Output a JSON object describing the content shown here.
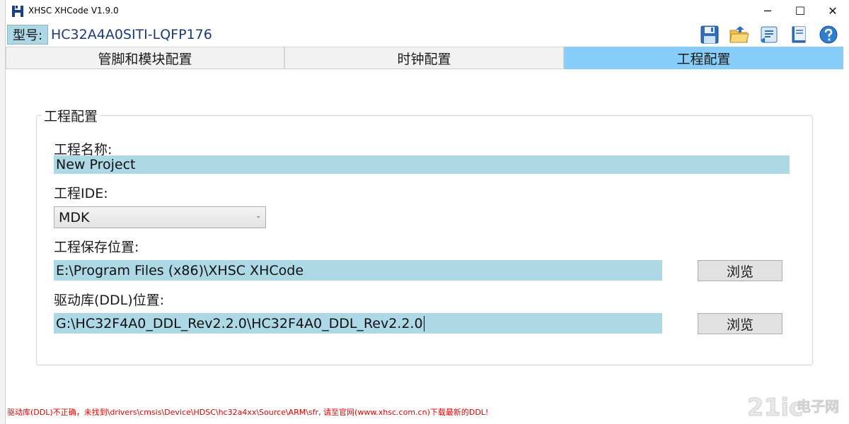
{
  "window": {
    "title": "XHSC XHCode V1.9.0",
    "controls": {
      "minimize": "─",
      "maximize": "☐",
      "close": "✕"
    }
  },
  "toolbar": {
    "model_label": "型号:",
    "model_value": "HC32A4A0SITI-LQFP176",
    "icons": [
      "save-icon",
      "open-folder-icon",
      "generate-code-icon",
      "book-icon",
      "help-icon"
    ]
  },
  "tabs": [
    {
      "label": "管脚和模块配置",
      "active": false
    },
    {
      "label": "时钟配置",
      "active": false
    },
    {
      "label": "工程配置",
      "active": true
    }
  ],
  "project": {
    "group_title": "工程配置",
    "name_label": "工程名称:",
    "name_value": "New Project",
    "ide_label": "工程IDE:",
    "ide_value": "MDK",
    "path_label": "工程保存位置:",
    "path_value": "E:\\Program Files (x86)\\XHSC XHCode",
    "path_browse": "浏览",
    "ddl_label": "驱动库(DDL)位置:",
    "ddl_value": "G:\\HC32F4A0_DDL_Rev2.2.0\\HC32F4A0_DDL_Rev2.2.0",
    "ddl_browse": "浏览"
  },
  "status": {
    "message": "驱动库(DDL)不正确，未找到\\drivers\\cmsis\\Device\\HDSC\\hc32a4xx\\Source\\ARM\\sfr, 请至官网(www.xhsc.com.cn)下载最新的DDL!"
  },
  "watermark": {
    "text": "21ic",
    "subtext": "电子网"
  },
  "colors": {
    "input_bg": "#add8e6",
    "active_tab": "#87cefa",
    "error_text": "#e00000",
    "model_text": "#1a3a7a"
  }
}
